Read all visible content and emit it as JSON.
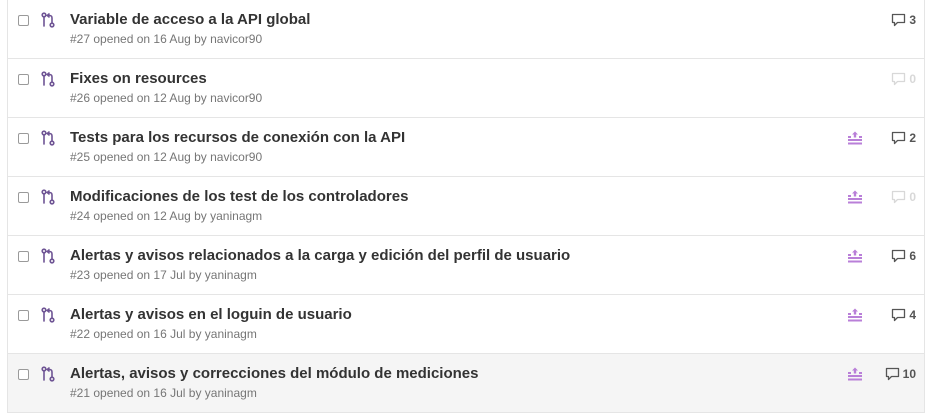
{
  "colors": {
    "pr_icon": "#6e5494",
    "status_icon": "#b97fd8",
    "title": "#333333",
    "meta": "#767676"
  },
  "pull_requests": [
    {
      "title": "Variable de acceso a la API global",
      "meta": "#27 opened on 16 Aug by navicor90",
      "comments": "3",
      "has_status": false,
      "hover": false
    },
    {
      "title": "Fixes on resources",
      "meta": "#26 opened on 12 Aug by navicor90",
      "comments": "0",
      "has_status": false,
      "hover": false
    },
    {
      "title": "Tests para los recursos de conexión con la API",
      "meta": "#25 opened on 12 Aug by navicor90",
      "comments": "2",
      "has_status": true,
      "hover": false
    },
    {
      "title": "Modificaciones de los test de los controladores",
      "meta": "#24 opened on 12 Aug by yaninagm",
      "comments": "0",
      "has_status": true,
      "hover": false
    },
    {
      "title": "Alertas y avisos relacionados a la carga y edición del perfil de usuario",
      "meta": "#23 opened on 17 Jul by yaninagm",
      "comments": "6",
      "has_status": true,
      "hover": false
    },
    {
      "title": "Alertas y avisos en el loguin de usuario",
      "meta": "#22 opened on 16 Jul by yaninagm",
      "comments": "4",
      "has_status": true,
      "hover": false
    },
    {
      "title": "Alertas, avisos y correcciones del módulo de mediciones",
      "meta": "#21 opened on 16 Jul by yaninagm",
      "comments": "10",
      "has_status": true,
      "hover": true
    }
  ]
}
